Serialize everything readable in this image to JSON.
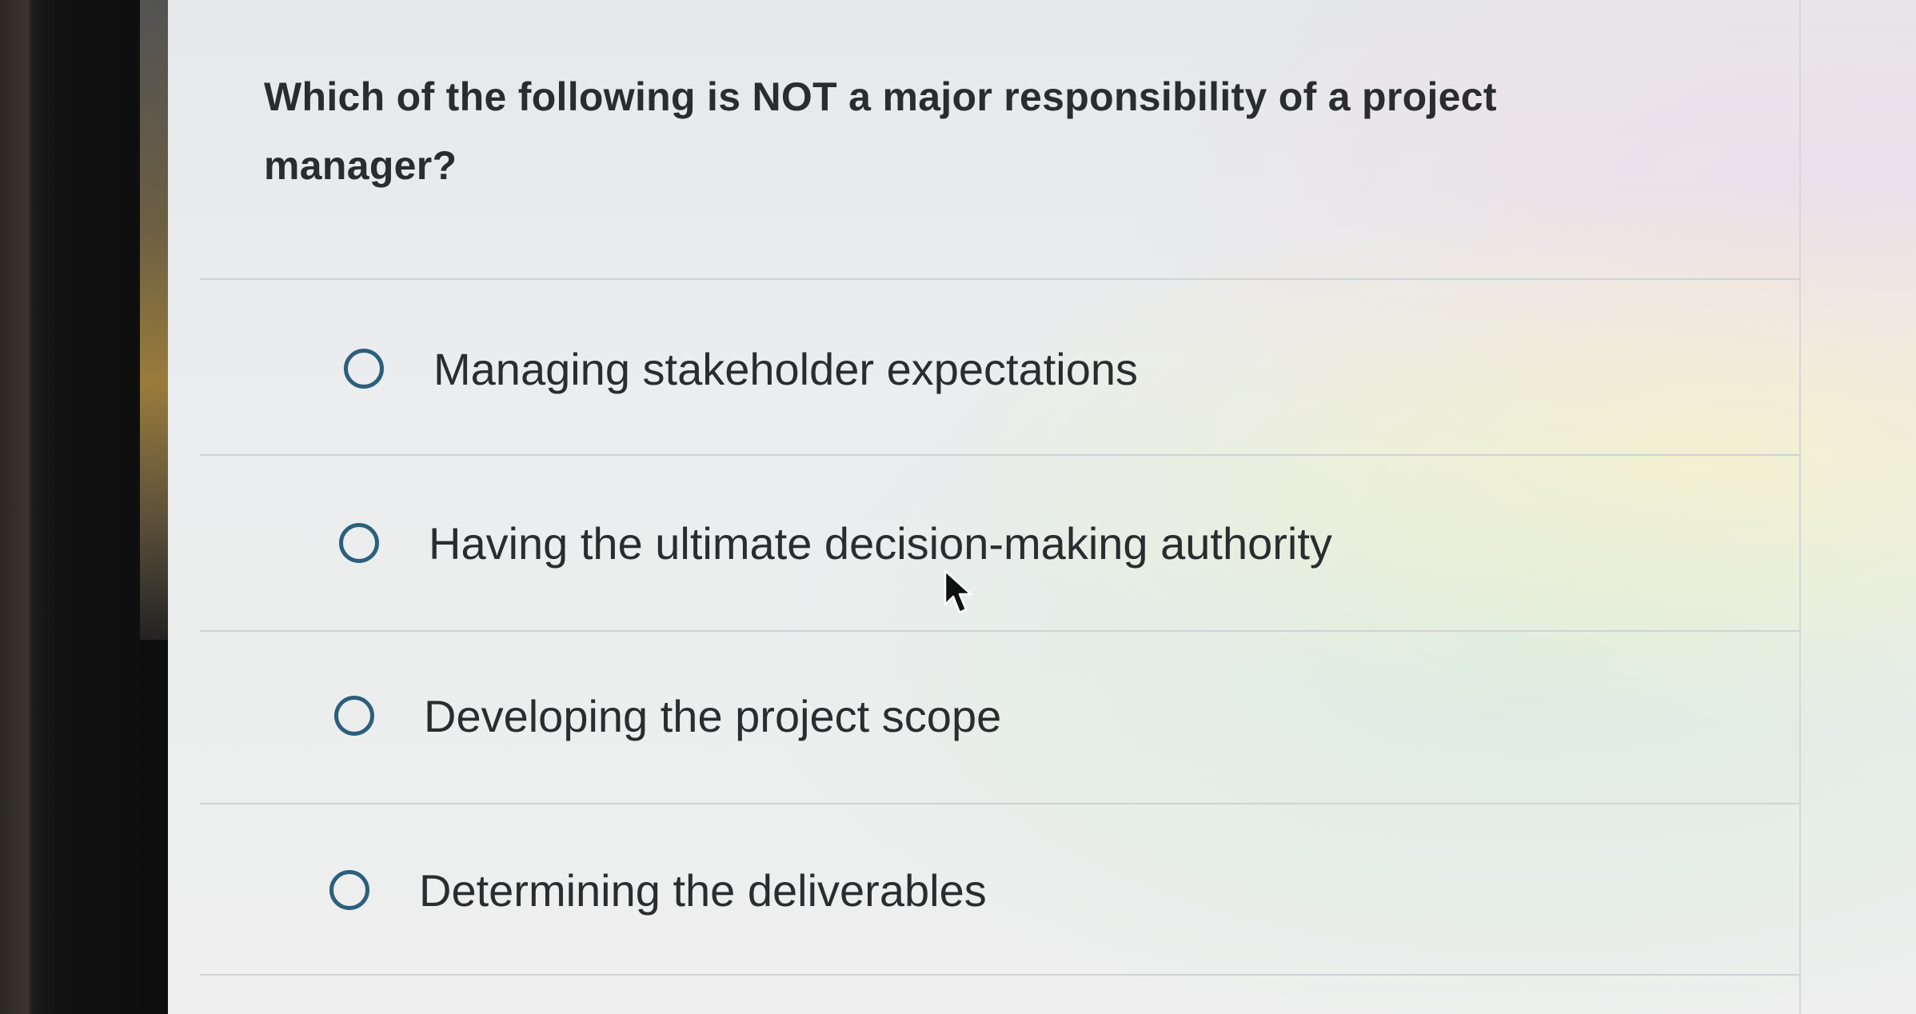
{
  "question": {
    "line1": "Which of the following is NOT a major responsibility of a project",
    "line2": "manager?"
  },
  "options": [
    {
      "label": "Managing stakeholder expectations",
      "selected": false
    },
    {
      "label": "Having the ultimate decision-making authority",
      "selected": false
    },
    {
      "label": "Developing the project scope",
      "selected": false
    },
    {
      "label": "Determining the deliverables",
      "selected": false
    }
  ],
  "colors": {
    "radio_border": "#2c5f7d",
    "text": "#2a2c2e",
    "divider": "#cfd2d4"
  },
  "icons": {
    "cursor": "mouse-pointer-icon",
    "radio": "radio-circle-icon"
  }
}
